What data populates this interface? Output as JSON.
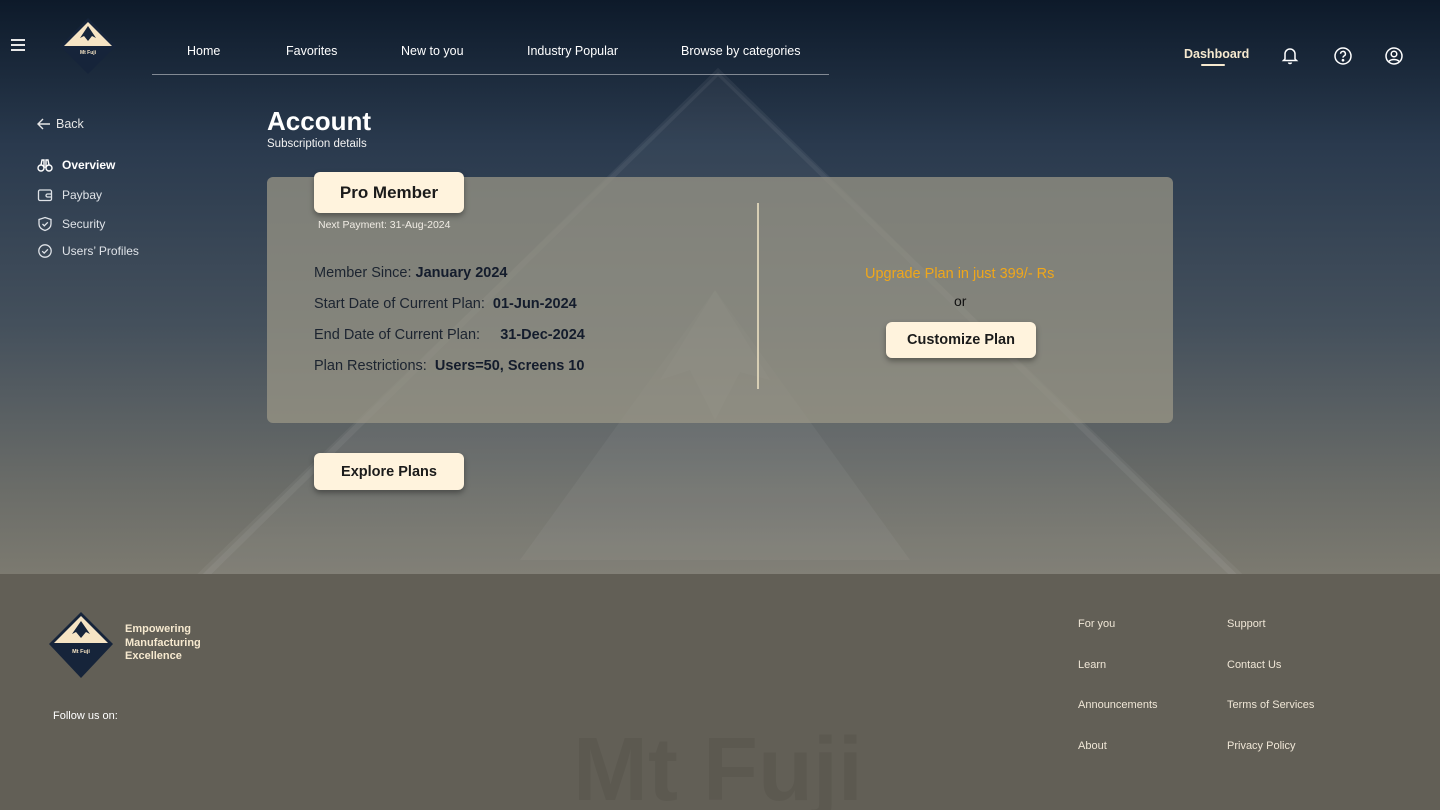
{
  "brand": {
    "logo_text": "Mt Fuji",
    "watermark_text": "Mt Fuji"
  },
  "nav": {
    "items": [
      {
        "label": "Home"
      },
      {
        "label": "Favorites"
      },
      {
        "label": "New to you"
      },
      {
        "label": "Industry Popular"
      },
      {
        "label": "Browse by categories"
      }
    ],
    "dashboard_label": "Dashboard"
  },
  "header_icons": [
    "bell-icon",
    "help-icon",
    "user-account-icon"
  ],
  "sidebar": {
    "back_label": "Back",
    "items": [
      {
        "label": "Overview",
        "icon": "binoculars-icon",
        "active": true
      },
      {
        "label": "Paybay",
        "icon": "wallet-icon",
        "active": false
      },
      {
        "label": "Security",
        "icon": "shield-icon",
        "active": false
      },
      {
        "label": "Users’ Profiles",
        "icon": "check-circle-icon",
        "active": false
      }
    ]
  },
  "page": {
    "title": "Account",
    "subtitle": "Subscription details"
  },
  "subscription": {
    "plan_name": "Pro Member",
    "next_payment": "Next Payment: 31-Aug-2024",
    "member_since_label": "Member Since:",
    "member_since_value": "January 2024",
    "start_label": "Start Date of Current Plan:",
    "start_value": "01-Jun-2024",
    "end_label": "End Date of Current Plan:",
    "end_value": "31-Dec-2024",
    "restrictions_label": "Plan Restrictions:",
    "restrictions_value": "Users=50, Screens 10",
    "upgrade_text": "Upgrade Plan in just 399/- Rs",
    "or_text": "or",
    "customize_label": "Customize Plan"
  },
  "explore_label": "Explore Plans",
  "footer": {
    "tagline": [
      "Empowering",
      "Manufacturing",
      "Excellence"
    ],
    "follow_label": "Follow us on:",
    "col1": [
      "For you",
      "Learn",
      "Announcements",
      "About"
    ],
    "col2": [
      "Support",
      "Contact Us",
      "Terms of Services",
      "Privacy Policy"
    ]
  },
  "colors": {
    "accent_cream": "#fff3dd",
    "upgrade_orange": "#f0a71a",
    "logo_navy": "#16243a"
  }
}
